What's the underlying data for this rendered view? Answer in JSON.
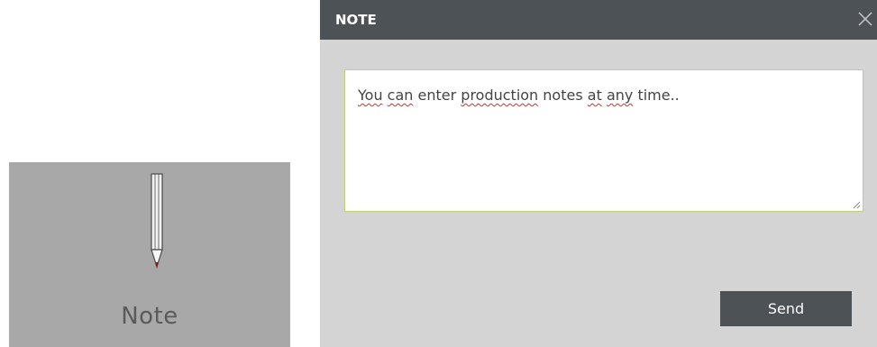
{
  "tile": {
    "label": "Note",
    "icon": "pencil-icon"
  },
  "dialog": {
    "title": "NOTE",
    "close_icon": "close-icon",
    "note": {
      "words": [
        "You",
        " ",
        "can",
        " enter ",
        "production",
        " notes ",
        "at",
        " ",
        "any",
        " time.."
      ],
      "full_value": "You can enter production notes at any time.."
    },
    "send_label": "Send"
  },
  "colors": {
    "tile_bg": "#a8a8a8",
    "dialog_bg": "#d4d4d4",
    "header_bg": "#4d5257",
    "button_bg": "#4d5257",
    "field_border": "#c3cf7a"
  }
}
